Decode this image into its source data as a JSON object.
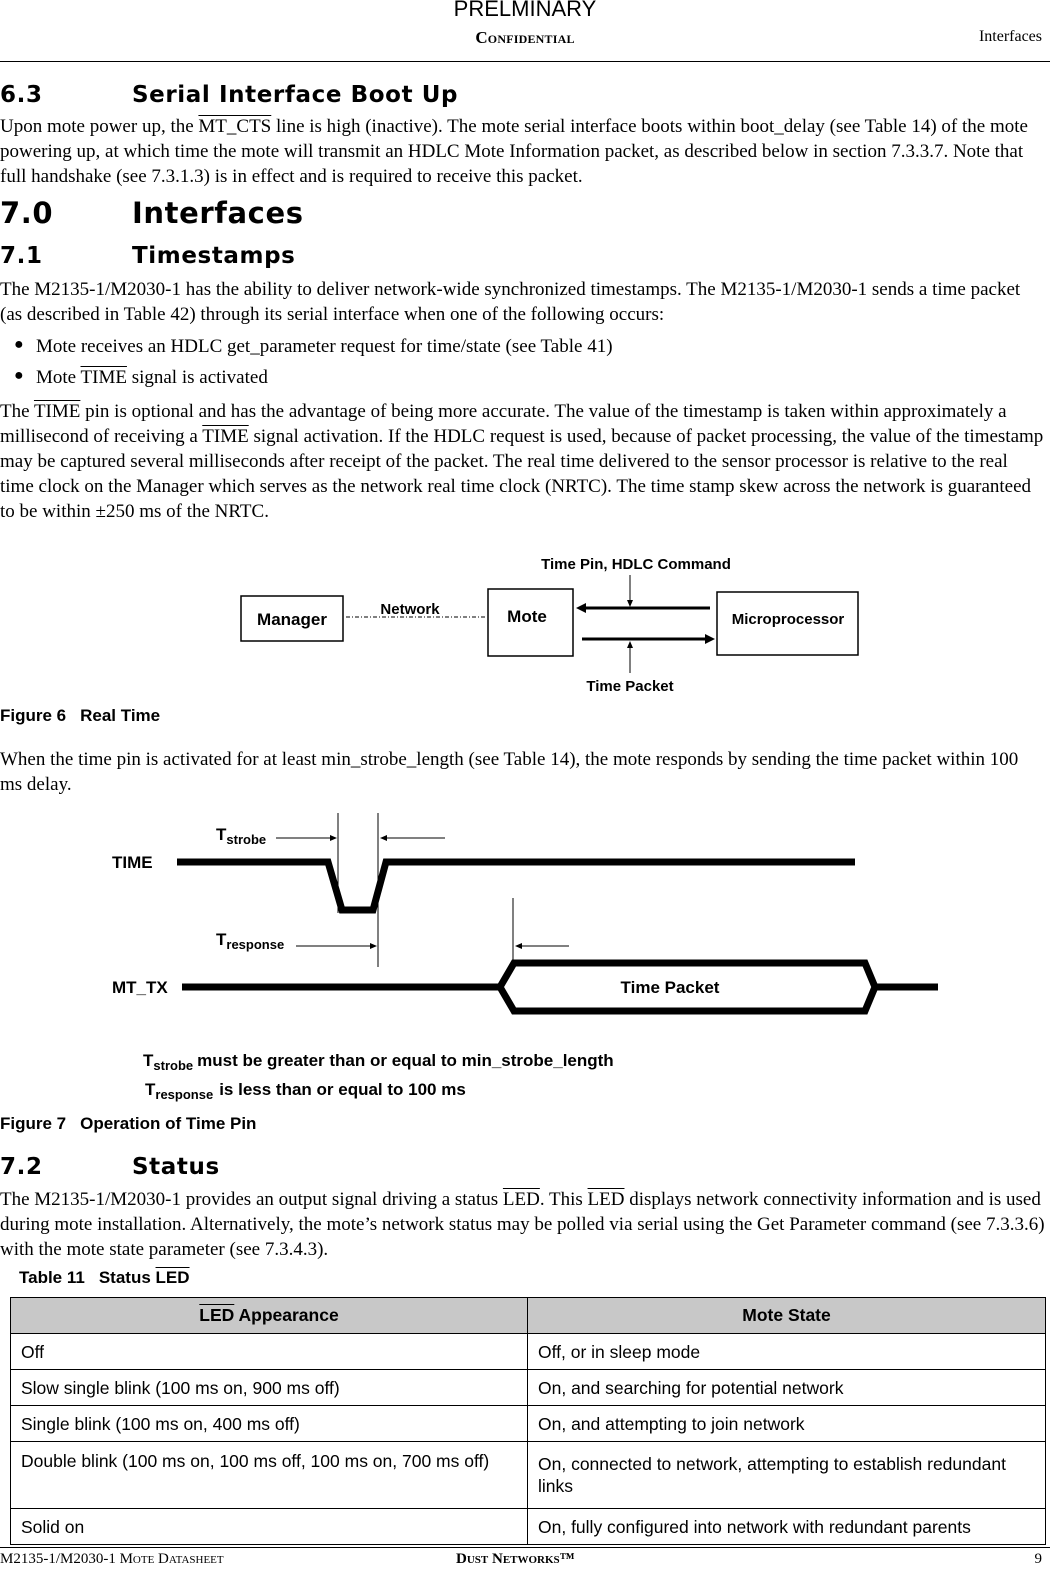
{
  "header": {
    "watermark": "PRELMINARY",
    "confidential": "Confidential",
    "section": "Interfaces"
  },
  "sec_6_3": {
    "number": "6.3",
    "title": "Serial Interface Boot Up",
    "p1_a": "Upon mote power up, the ",
    "p1_ov": "MT_CTS",
    "p1_b": " line is high (inactive). The mote serial interface boots within boot_delay (see Table 14) of the mote powering up, at which time the mote will transmit an HDLC Mote Information packet, as described below in section 7.3.3.7. Note that full handshake (see 7.3.1.3) is in effect and is required to receive this packet."
  },
  "sec_7_0": {
    "number": "7.0",
    "title": "Interfaces"
  },
  "sec_7_1": {
    "number": "7.1",
    "title": "Timestamps",
    "intro": "The M2135-1/M2030-1 has the ability to deliver network-wide synchronized timestamps. The M2135-1/M2030-1 sends a time packet (as described in Table 42) through its serial interface when one of the following occurs:",
    "bullets": [
      {
        "pre": "Mote receives an HDLC get_parameter request for time/state (see Table 41)",
        "ov": "",
        "post": ""
      },
      {
        "pre": "Mote ",
        "ov": "TIME",
        "post": " signal is activated"
      }
    ],
    "p2_a": "The ",
    "p2_ov1": "TIME",
    "p2_b": " pin is optional and has the advantage of being more accurate. The value of the timestamp is taken within approximately a millisecond of receiving a ",
    "p2_ov2": "TIME",
    "p2_c": " signal activation. If the HDLC request is used, because of packet processing, the value of the timestamp may be captured several milliseconds after receipt of the packet. The real time delivered to the sensor processor is relative to the real time clock on the Manager which serves as the network real time clock (NRTC). The time stamp skew across the network is guaranteed to be within ±250 ms of the NRTC."
  },
  "figure6": {
    "label": "Figure 6",
    "title": "Real Time",
    "nodes": {
      "manager": "Manager",
      "mote": "Mote",
      "microprocessor": "Microprocessor"
    },
    "edge_network": "Network",
    "label_top": "Time Pin, HDLC Command",
    "label_bottom": "Time Packet"
  },
  "after_fig6": "When the time pin is activated for at least min_strobe_length (see Table 14), the mote responds by sending the time packet within 100 ms delay.",
  "figure7": {
    "label": "Figure 7",
    "title": "Operation of Time Pin",
    "signal_time": "TIME",
    "signal_mttx": "MT_TX",
    "t_main": "T",
    "t_strobe_sub": "strobe",
    "t_response_sub": "response",
    "packet": "Time Packet",
    "note1": "must be greater than or equal to min_strobe_length",
    "note2": "is less than or equal to 100 ms"
  },
  "sec_7_2": {
    "number": "7.2",
    "title": "Status",
    "p_a": "The M2135-1/M2030-1 provides an output signal driving a status ",
    "p_ov1": "LED",
    "p_b": ". This ",
    "p_ov2": "LED",
    "p_c": " displays network connectivity information and is used during mote installation. Alternatively, the mote’s network status may be polled via serial using the Get Parameter command (see 7.3.3.6) with the mote state parameter (see 7.3.4.3)."
  },
  "table11": {
    "label": "Table 11",
    "title_pre": "Status ",
    "title_ov": "LED",
    "headers": [
      {
        "ov": "LED",
        "rest": " Appearance"
      },
      {
        "ov": "",
        "rest": "Mote State"
      }
    ],
    "rows": [
      [
        "Off",
        "Off, or in sleep mode"
      ],
      [
        "Slow single blink (100 ms on, 900 ms off)",
        "On, and searching for potential network"
      ],
      [
        "Single blink (100 ms on, 400 ms off)",
        "On, and attempting to join network"
      ],
      [
        "Double blink (100 ms on, 100 ms off, 100 ms on, 700 ms off)",
        "On, connected to network, attempting to establish redundant links"
      ],
      [
        "Solid on",
        "On, fully configured into network with redundant parents"
      ]
    ]
  },
  "footer": {
    "doc": "M2135-1/M2030-1 Mote Datasheet",
    "company": "Dust Networks™",
    "page": "9"
  }
}
